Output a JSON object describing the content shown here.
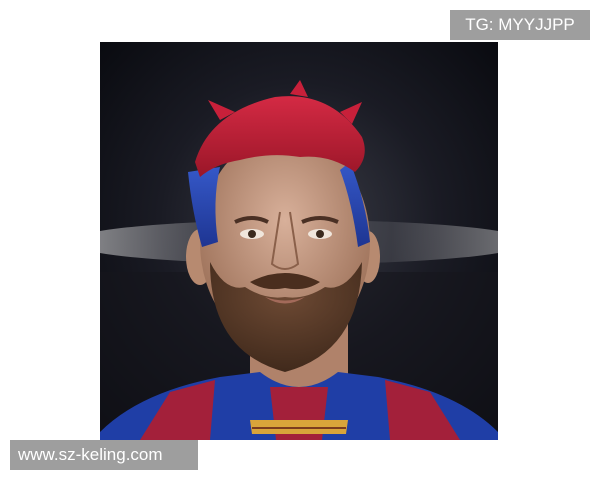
{
  "watermark_top": {
    "text": "TG: MYYJJPP"
  },
  "watermark_bottom": {
    "text": "www.sz-keling.com"
  },
  "photo": {
    "subject": "portrait of a bearded man with red and blue dyed hair wearing a red and blue striped football jersey in a stadium",
    "colors": {
      "background_dark": "#0d0e14",
      "hair_red": "#c8203a",
      "hair_blue": "#2a48b0",
      "skin": "#c79a7e",
      "beard": "#5b3a28",
      "jersey_blue": "#1f3ea6",
      "jersey_red": "#a3203a",
      "collar_gold": "#d9a43a"
    }
  }
}
